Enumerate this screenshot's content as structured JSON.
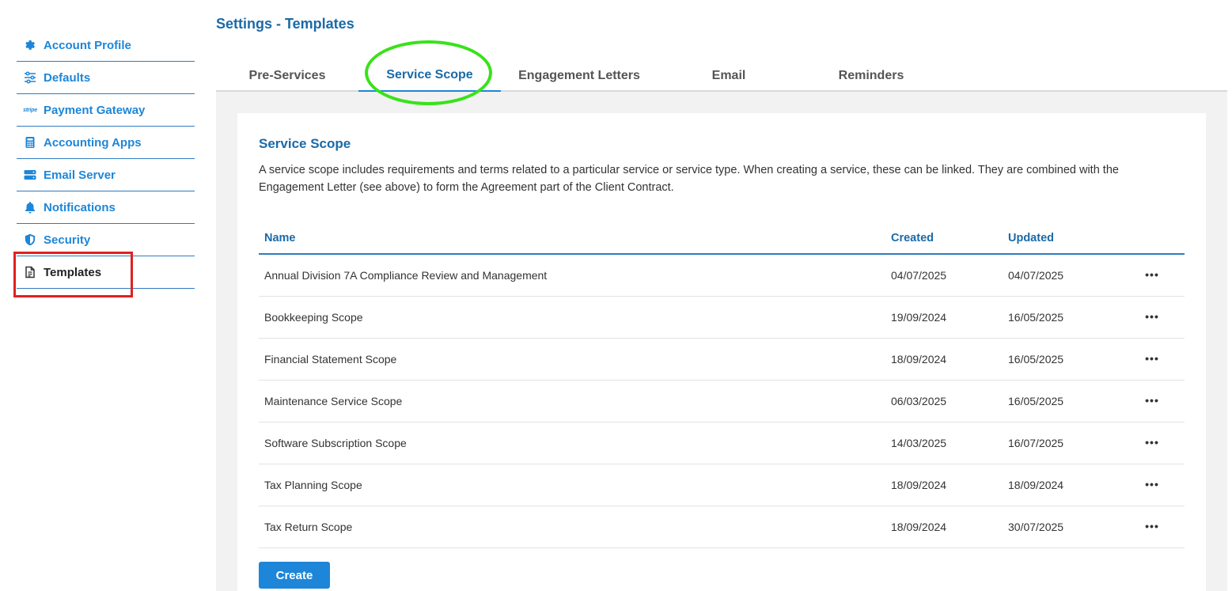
{
  "page_title": "Settings - Templates",
  "sidebar": {
    "items": [
      {
        "label": "Account Profile",
        "icon": "gear-icon"
      },
      {
        "label": "Defaults",
        "icon": "sliders-icon"
      },
      {
        "label": "Payment Gateway",
        "icon": "stripe-icon",
        "icon_text": "stripe"
      },
      {
        "label": "Accounting Apps",
        "icon": "calculator-icon"
      },
      {
        "label": "Email Server",
        "icon": "server-icon"
      },
      {
        "label": "Notifications",
        "icon": "bell-icon"
      },
      {
        "label": "Security",
        "icon": "shield-icon"
      },
      {
        "label": "Templates",
        "icon": "document-icon",
        "active": true
      }
    ]
  },
  "tabs": [
    {
      "label": "Pre-Services"
    },
    {
      "label": "Service Scope",
      "active": true
    },
    {
      "label": "Engagement Letters"
    },
    {
      "label": "Email"
    },
    {
      "label": "Reminders"
    }
  ],
  "section": {
    "title": "Service Scope",
    "description": "A service scope includes requirements and terms related to a particular service or service type. When creating a service, these can be linked. They are combined with the Engagement Letter (see above) to form the Agreement part of the Client Contract."
  },
  "table": {
    "headers": {
      "name": "Name",
      "created": "Created",
      "updated": "Updated"
    },
    "rows": [
      {
        "name": "Annual Division 7A Compliance Review and Management",
        "created": "04/07/2025",
        "updated": "04/07/2025"
      },
      {
        "name": "Bookkeeping Scope",
        "created": "19/09/2024",
        "updated": "16/05/2025"
      },
      {
        "name": "Financial Statement Scope",
        "created": "18/09/2024",
        "updated": "16/05/2025"
      },
      {
        "name": "Maintenance Service Scope",
        "created": "06/03/2025",
        "updated": "16/05/2025"
      },
      {
        "name": "Software Subscription Scope",
        "created": "14/03/2025",
        "updated": "16/07/2025"
      },
      {
        "name": "Tax Planning Scope",
        "created": "18/09/2024",
        "updated": "18/09/2024"
      },
      {
        "name": "Tax Return Scope",
        "created": "18/09/2024",
        "updated": "30/07/2025"
      }
    ],
    "more_glyph": "•••"
  },
  "create_label": "Create",
  "colors": {
    "accent": "#1d86d8",
    "title": "#1a6aa8",
    "highlight_box": "#e02020",
    "highlight_circle": "#39e21a"
  }
}
